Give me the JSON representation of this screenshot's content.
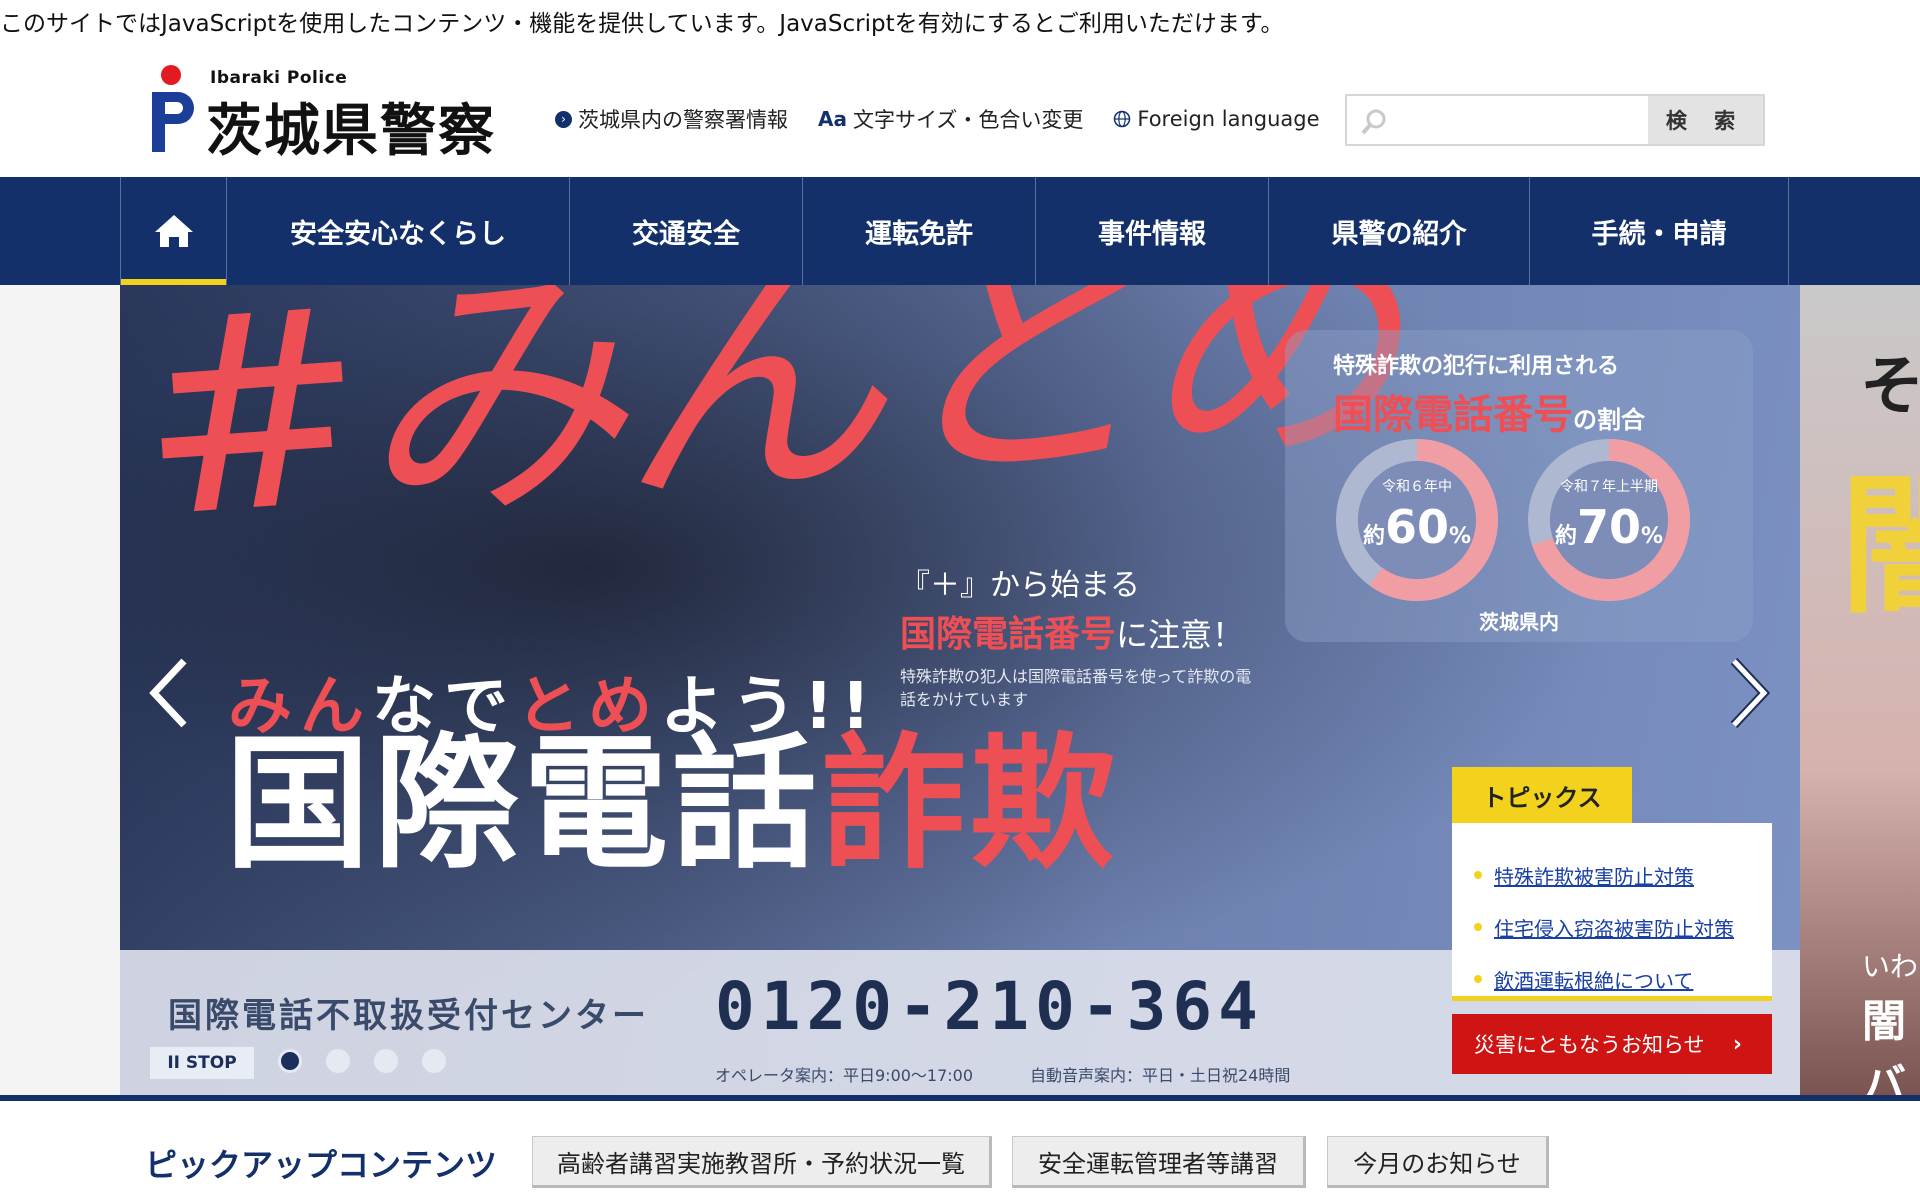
{
  "js_notice": "このサイトではJavaScriptを使用したコンテンツ・機能を提供しています。JavaScriptを有効にするとご利用いただけます。",
  "logo": {
    "en": "Ibaraki Police",
    "ja": "茨城県警察"
  },
  "header_links": [
    {
      "label": "茨城県内の警察署情報",
      "icon": "circle-arrow-icon"
    },
    {
      "label": "文字サイズ・色合い変更",
      "icon": "aa-text-size-icon"
    },
    {
      "label": "Foreign language",
      "icon": "globe-icon"
    }
  ],
  "search": {
    "placeholder": "",
    "button": "検 索"
  },
  "nav": {
    "home_icon": "home-icon",
    "items": [
      "安全安心なくらし",
      "交通安全",
      "運転免許",
      "事件情報",
      "県警の紹介",
      "手続・申請"
    ]
  },
  "hero": {
    "hashtag": "#みんとめ",
    "sub_catch_a": "み",
    "sub_catch_b": "ん",
    "sub_catch_c": "なで",
    "sub_catch_d": "と",
    "sub_catch_e": "め",
    "sub_catch_f": "よう!!",
    "main_white": "国際電話",
    "main_red": "詐欺",
    "notice_1": "『＋』から始まる",
    "notice_2_red": "国際電話番号",
    "notice_2_white": "に注意！",
    "notice_3": "特殊詐欺の犯人は国際電話番号を使って詐欺の電話をかけています",
    "stats": {
      "title1": "特殊詐欺の犯行に利用される",
      "title2": "国際電話番号",
      "title2_suffix": "の割合",
      "items": [
        {
          "label": "令和６年中",
          "prefix": "約",
          "value": "60",
          "unit": "%",
          "ratio": 0.6
        },
        {
          "label": "令和７年上半期",
          "prefix": "約",
          "value": "70",
          "unit": "%",
          "ratio": 0.7
        }
      ],
      "footer": "茨城県内"
    },
    "phone_label": "国際電話不取扱受付センター",
    "phone_number": "0120-210-364",
    "phone_sub1": "オペレータ案内：平日9:00～17:00",
    "phone_sub2": "自動音声案内：平日・土日祝24時間",
    "stop_label": "II STOP",
    "slide_count": 4,
    "active_slide": 1
  },
  "hero_peek": {
    "t1": "そ",
    "t2": "闇",
    "t3": "いわ",
    "t4": "闇バ"
  },
  "topics": {
    "tab": "トピックス",
    "links": [
      "特殊詐欺被害防止対策",
      "住宅侵入窃盗被害防止対策",
      "飲酒運転根絶について"
    ],
    "disaster": "災害にともなうお知らせ"
  },
  "pickup": {
    "title": "ピックアップコンテンツ",
    "buttons": [
      "高齢者講習実施教習所・予約状況一覧",
      "安全運転管理者等講習",
      "今月のお知らせ"
    ]
  },
  "colors": {
    "navy": "#13306b",
    "accent_yellow": "#f3d21d",
    "accent_red": "#ee4f55",
    "alert_red": "#cf1414"
  }
}
